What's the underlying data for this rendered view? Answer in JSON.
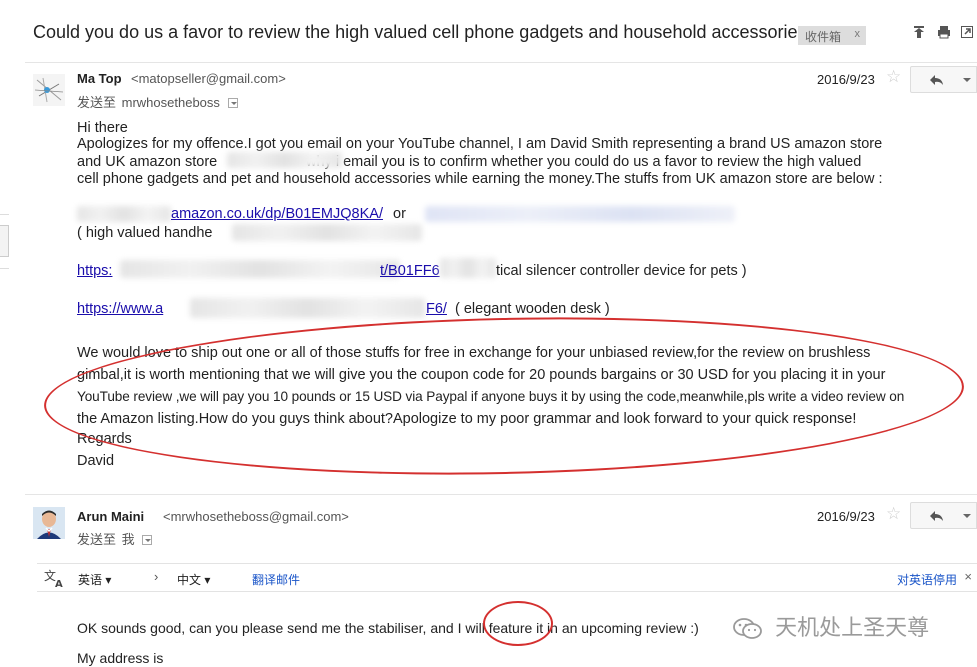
{
  "subject": "Could you do us a favor to review the high valued cell phone gadgets and household accessories",
  "label": {
    "name": "收件箱",
    "close": "x"
  },
  "messages": [
    {
      "sender_name": "Ma Top",
      "sender_email": "<matopseller@gmail.com>",
      "to_prefix": "发送至",
      "to": "mrwhosetheboss",
      "date": "2016/9/23",
      "body": {
        "greeting": "Hi there",
        "intro_lines": [
          "Apologizes for my offence.I got you email on your YouTube channel, I am David Smith representing a brand US amazon store",
          "and UK amazon store",
          "why i email you is to confirm whether you could do us a favor to review the high valued",
          "cell phone gadgets and pet and household accessories while earning the money.The stuffs from UK amazon store are below :"
        ],
        "link1": "amazon.co.uk/dp/B01EMJQ8KA/",
        "link1_or": "or",
        "link1_note": "( high valued handhe",
        "link2_prefix": "https:",
        "link2_mid": "t/B01FF6",
        "link2_note": "tical silencer controller device for pets )",
        "link3_prefix": "https://www.a",
        "link3_suffix": "F6/",
        "link3_note": "( elegant wooden desk )",
        "offer_lines": [
          "We would love to ship out one or all of those stuffs for free in exchange for your unbiased review,for the review on brushless",
          "gimbal,it is worth mentioning that we will give you the coupon code for 20 pounds bargains or 30 USD for you placing it in your",
          "YouTube review ,we will pay you 10 pounds or 15 USD via Paypal if anyone buys it by using the code,meanwhile,pls write a video review on",
          "the Amazon listing.How do you guys think about?Apologize to my poor grammar and look forward to your quick response!"
        ],
        "regards": "Regards",
        "signature": "David"
      }
    },
    {
      "sender_name": "Arun Maini",
      "sender_email": "<mrwhosetheboss@gmail.com>",
      "to_prefix": "发送至",
      "to": "我",
      "date": "2016/9/23",
      "body": {
        "line1": "OK sounds good, can you please send me the stabiliser, and I will feature it in an upcoming review :)",
        "line2": "My address is"
      }
    }
  ],
  "translate_bar": {
    "source_lang": "英语",
    "target_lang": "中文",
    "translate_action": "翻译邮件",
    "stop_action": "对英语停用",
    "close": "×"
  },
  "watermark": "天机处上圣天尊",
  "colors": {
    "annotation": "#d4302f",
    "link": "#1a0dab"
  }
}
